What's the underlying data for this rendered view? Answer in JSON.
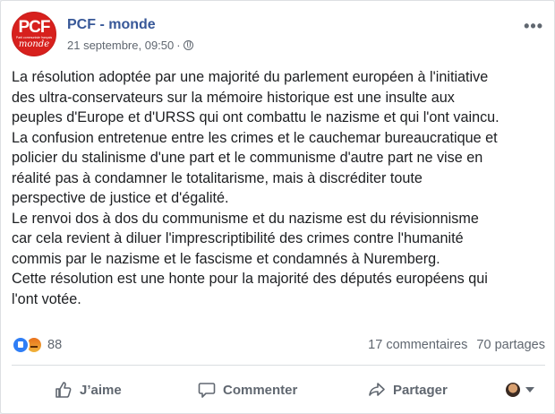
{
  "post": {
    "page_name": "PCF - monde",
    "timestamp": "21 septembre, 09:50",
    "timestamp_separator": "·",
    "avatar_logo": {
      "main": "PCF",
      "sub": "Parti communiste français",
      "script": "monde"
    },
    "more_label": "•••",
    "text": "La résolution adoptée par une majorité du parlement européen à l'initiative\ndes ultra-conservateurs sur la mémoire historique est une insulte aux\npeuples d'Europe et d'URSS qui ont combattu le nazisme et qui l'ont vaincu.\nLa confusion entretenue entre les crimes et le cauchemar bureaucratique et\npolicier du stalinisme d'une part et le communisme d'autre part ne vise en\nréalité pas à condamner le totalitarisme, mais à discréditer toute\nperspective de justice et d'égalité.\nLe renvoi dos à dos du communisme et du nazisme est du révisionnisme\ncar cela revient à diluer l'imprescriptibilité des crimes contre l'humanité\ncommis par le nazisme et le fascisme et condamnés à Nuremberg.\nCette résolution est une honte pour la majorité des députés européens qui\nl'ont votée."
  },
  "reactions": {
    "count": "88",
    "icons": [
      "like-reaction-icon",
      "angry-reaction-icon"
    ],
    "comments": "17 commentaires",
    "shares": "70 partages"
  },
  "actions": {
    "like": "J’aime",
    "comment": "Commenter",
    "share": "Partager"
  },
  "colors": {
    "link": "#385898",
    "secondary_text": "#606770",
    "like_blue": "#2f7ef6",
    "brand_red": "#d7201d"
  }
}
